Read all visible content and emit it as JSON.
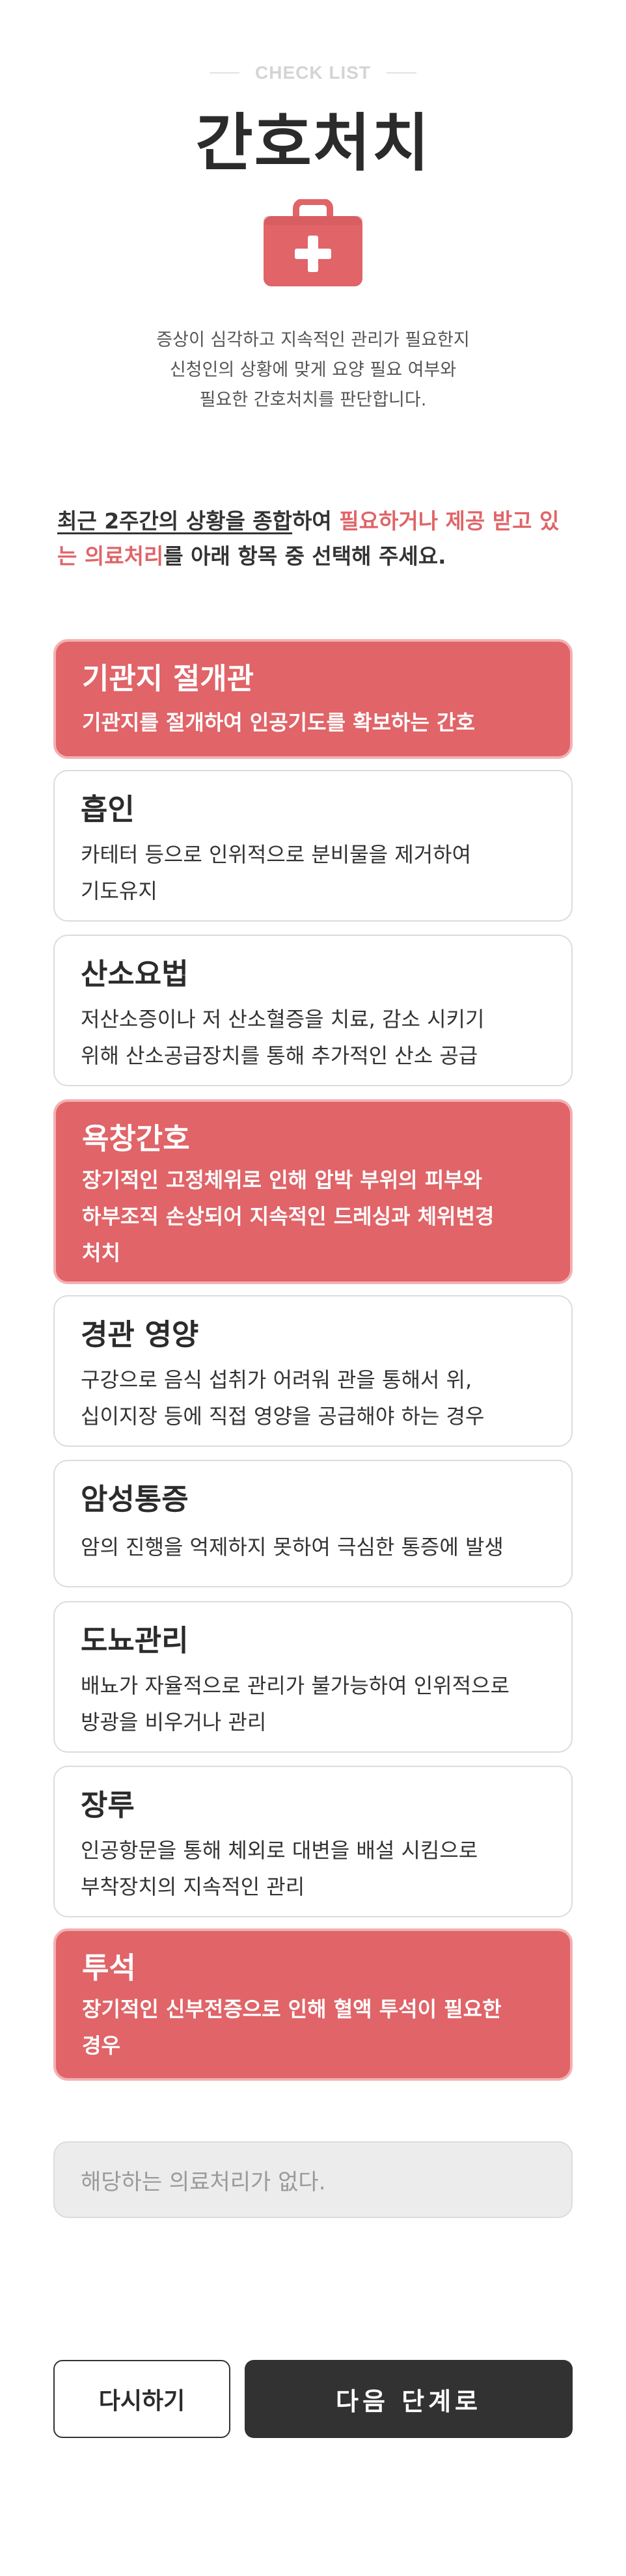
{
  "header": {
    "eyebrow": "CHECK LIST",
    "title": "간호처치",
    "icon": "first-aid-kit-icon",
    "intro_lines": [
      "증상이 심각하고 지속적인 관리가 필요한지",
      "신청인의 상황에 맞게 요양 필요 여부와",
      "필요한 간호처치를 판단합니다."
    ]
  },
  "guide": {
    "underlined": "최근 2주간의 상황을 종합",
    "part2": "하여 ",
    "highlight": "필요하거나 제공 받고 있는 의료처리",
    "part3": "를 아래 항목 중 선택해 주세요."
  },
  "options": [
    {
      "title": "기관지 절개관",
      "lines": [
        "기관지를 절개하여 인공기도를 확보하는 간호"
      ],
      "selected": true
    },
    {
      "title": "흡인",
      "lines": [
        "카테터 등으로 인위적으로 분비물을 제거하여",
        "기도유지"
      ],
      "selected": false
    },
    {
      "title": "산소요법",
      "lines": [
        "저산소증이나 저 산소혈증을 치료, 감소 시키기",
        "위해 산소공급장치를 통해 추가적인 산소 공급"
      ],
      "selected": false
    },
    {
      "title": "욕창간호",
      "lines": [
        "장기적인 고정체위로 인해 압박 부위의 피부와",
        "하부조직 손상되어 지속적인 드레싱과 체위변경",
        "처치"
      ],
      "selected": true
    },
    {
      "title": "경관 영양",
      "lines": [
        "구강으로 음식 섭취가 어려워 관을 통해서 위,",
        "십이지장 등에 직접 영양을 공급해야 하는 경우"
      ],
      "selected": false
    },
    {
      "title": "암성통증",
      "lines": [
        "암의 진행을 억제하지 못하여 극심한 통증에 발생"
      ],
      "selected": false
    },
    {
      "title": "도뇨관리",
      "lines": [
        "배뇨가 자율적으로 관리가 불가능하여 인위적으로",
        "방광을 비우거나 관리"
      ],
      "selected": false
    },
    {
      "title": "장루",
      "lines": [
        "인공항문을 통해 체외로 대변을 배설 시킴으로",
        "부착장치의 지속적인 관리"
      ],
      "selected": false
    },
    {
      "title": "투석",
      "lines": [
        "장기적인 신부전증으로 인해 혈액 투석이 필요한",
        "경우"
      ],
      "selected": true
    }
  ],
  "none_option": "해당하는 의료처리가 없다.",
  "buttons": {
    "retry": "다시하기",
    "next": "다음 단계로"
  },
  "colors": {
    "accent": "#e06468",
    "accent_border": "#f3b0b2",
    "dark": "#323232"
  }
}
